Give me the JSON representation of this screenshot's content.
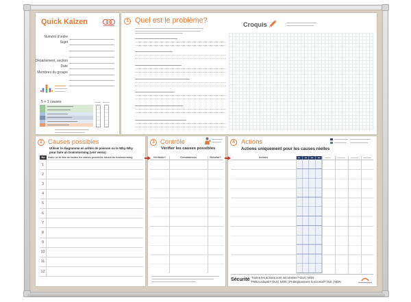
{
  "colors": {
    "accent": "#e07b39",
    "board": "#d8cfc2",
    "frame": "#c8c8c8",
    "header_dark": "#3a3a3a",
    "navy": "#2d3f6e",
    "arrow": "#c0392b"
  },
  "icons": {
    "kaizen_logo": "kaizen-logo-icon",
    "team": "team-icon",
    "pencil": "pencil-icon",
    "inspector": "inspector-icon",
    "brand_logo": "brand-logo-icon",
    "arrow": "arrow-right-icon"
  },
  "kaizen": {
    "title": "Quick Kaizen",
    "fields": {
      "order_number": "Numéro d'ordre",
      "subject": "Sujet",
      "department": "Département, section",
      "date": "Date",
      "members": "Membres du groupe"
    },
    "causes_heading": "5 + 1 causes"
  },
  "problem": {
    "number": "1",
    "title": "Quel est le problème?",
    "sketch_label": "Croquis"
  },
  "causes": {
    "number": "2",
    "title": "Causes possibles",
    "instruction_line1": "Utiliser le diagramme en arêtes de poisson ou le Why-Why",
    "instruction_line2": "pour faire un brainstorming (voir verso)",
    "col_no": "No",
    "col_list": "Notez ici la liste de toutes les causes possibles issues du brainstorming",
    "rows": [
      "1",
      "2",
      "3",
      "4",
      "5",
      "6",
      "7",
      "8",
      "9",
      "10",
      "11",
      "12"
    ]
  },
  "control": {
    "number": "3",
    "title": "Contrôle",
    "subtitle": "Vérifier les causes possibles",
    "columns": [
      "Vérifiable?",
      "Constatations",
      "Résultat?"
    ]
  },
  "actions": {
    "number": "4",
    "title": "Actions",
    "subtitle": "Actions uniquement pour les causes réelles",
    "col_actions": "Actions",
    "safety": {
      "label": "Sécurité",
      "q_secured": "Toutes les actions sont sécurisées? OUI | NON",
      "q_fmea": "FMEA adapté? OUI | NON | PA",
      "q_deploy": "Déploiement horizontal? OUI | NON"
    }
  }
}
